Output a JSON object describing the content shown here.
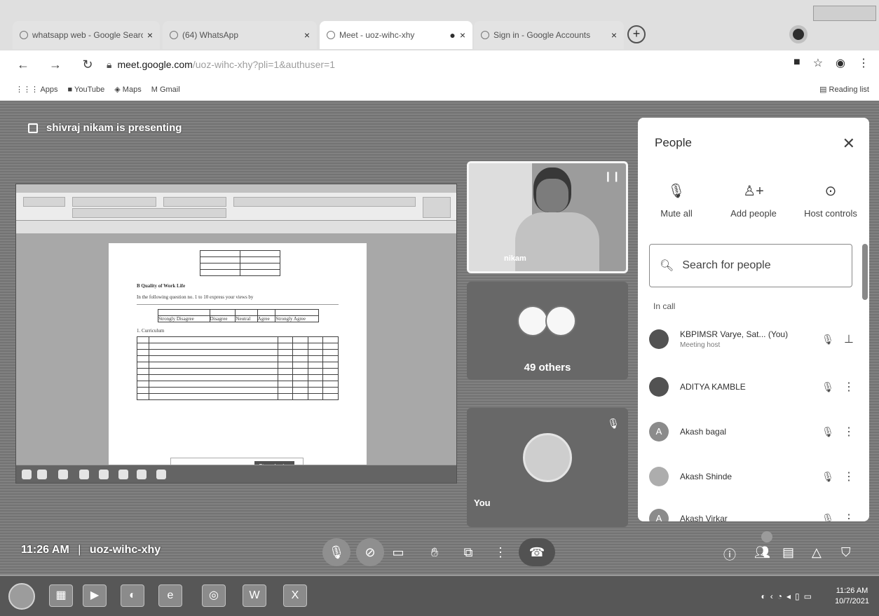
{
  "browser": {
    "tabs": [
      {
        "title": "whatsapp web - Google Search",
        "active": false
      },
      {
        "title": "(64) WhatsApp",
        "active": false
      },
      {
        "title": "Meet - uoz-wihc-xhy",
        "active": true
      },
      {
        "title": "Sign in - Google Accounts",
        "active": false
      }
    ],
    "url_host": "meet.google.com",
    "url_path": "/uoz-wihc-xhy?pli=1&authuser=1",
    "bookmarks": [
      "Apps",
      "YouTube",
      "Maps",
      "Gmail"
    ],
    "reading_list": "Reading list"
  },
  "meet": {
    "presenting_text": "shivraj nikam is presenting",
    "presenter_tile_name": "nikam",
    "others_label": "49 others",
    "self_label": "You",
    "time": "11:26 AM",
    "separator": "|",
    "meeting_code": "uoz-wihc-xhy",
    "participant_badge": "",
    "shared_doc": {
      "section_heading": "B  Quality of Work Life",
      "instruction": "In the following question no. 1 to 10 express your views by",
      "scale": [
        "Strongly Disagree",
        "Disagree",
        "Neutral",
        "Agree",
        "Strongly Agree"
      ],
      "subsection": "1.  Curriculum",
      "stop_button": "Stop sharing"
    }
  },
  "people_panel": {
    "title": "People",
    "actions": [
      {
        "label": "Mute all",
        "icon": "mic-off-icon"
      },
      {
        "label": "Add people",
        "icon": "person-add-icon"
      },
      {
        "label": "Host controls",
        "icon": "toggle-icon"
      }
    ],
    "search_placeholder": "Search for people",
    "section_label": "In call",
    "participants": [
      {
        "name": "KBPIMSR Varye, Sat...",
        "you": "(You)",
        "sub": "Meeting host",
        "initial": ""
      },
      {
        "name": "ADITYA KAMBLE",
        "you": "",
        "sub": "",
        "initial": ""
      },
      {
        "name": "Akash bagal",
        "you": "",
        "sub": "",
        "initial": "A"
      },
      {
        "name": "Akash Shinde",
        "you": "",
        "sub": "",
        "initial": ""
      },
      {
        "name": "Akash Virkar",
        "you": "",
        "sub": "",
        "initial": "A"
      }
    ]
  },
  "taskbar": {
    "clock_time": "11:26 AM",
    "clock_date": "10/7/2021"
  }
}
